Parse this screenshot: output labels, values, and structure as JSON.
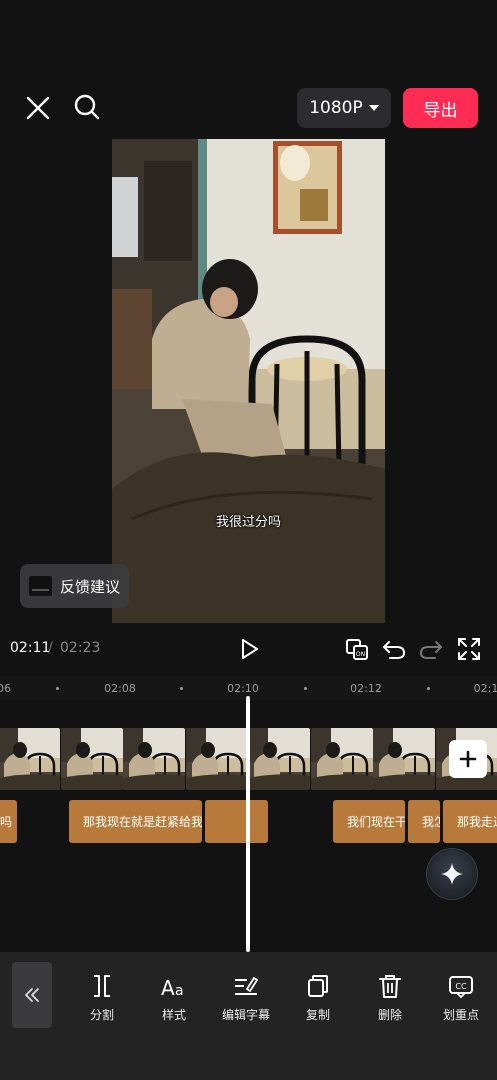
{
  "topbar": {
    "resolution_label": "1080P",
    "export_label": "导出"
  },
  "preview": {
    "subtitle": "我很过分吗"
  },
  "feedback": {
    "label": "反馈建议"
  },
  "controls": {
    "current_time": "02:11",
    "separator": "/",
    "total_time": "02:23"
  },
  "timeline": {
    "ruler_labels": [
      "06",
      "02:08",
      "02:10",
      "02:12",
      "02:1"
    ],
    "subtitle_clips": [
      "吗",
      "那我现在就是赶紧给我",
      "",
      "我们现在干",
      "我怎",
      "那我走过"
    ]
  },
  "toolbar": {
    "tools": [
      "分割",
      "样式",
      "编辑字幕",
      "复制",
      "删除",
      "划重点"
    ]
  },
  "colors": {
    "accent_export": "#fe2c55",
    "clip_fill": "#b77a3a",
    "background": "#121212"
  }
}
